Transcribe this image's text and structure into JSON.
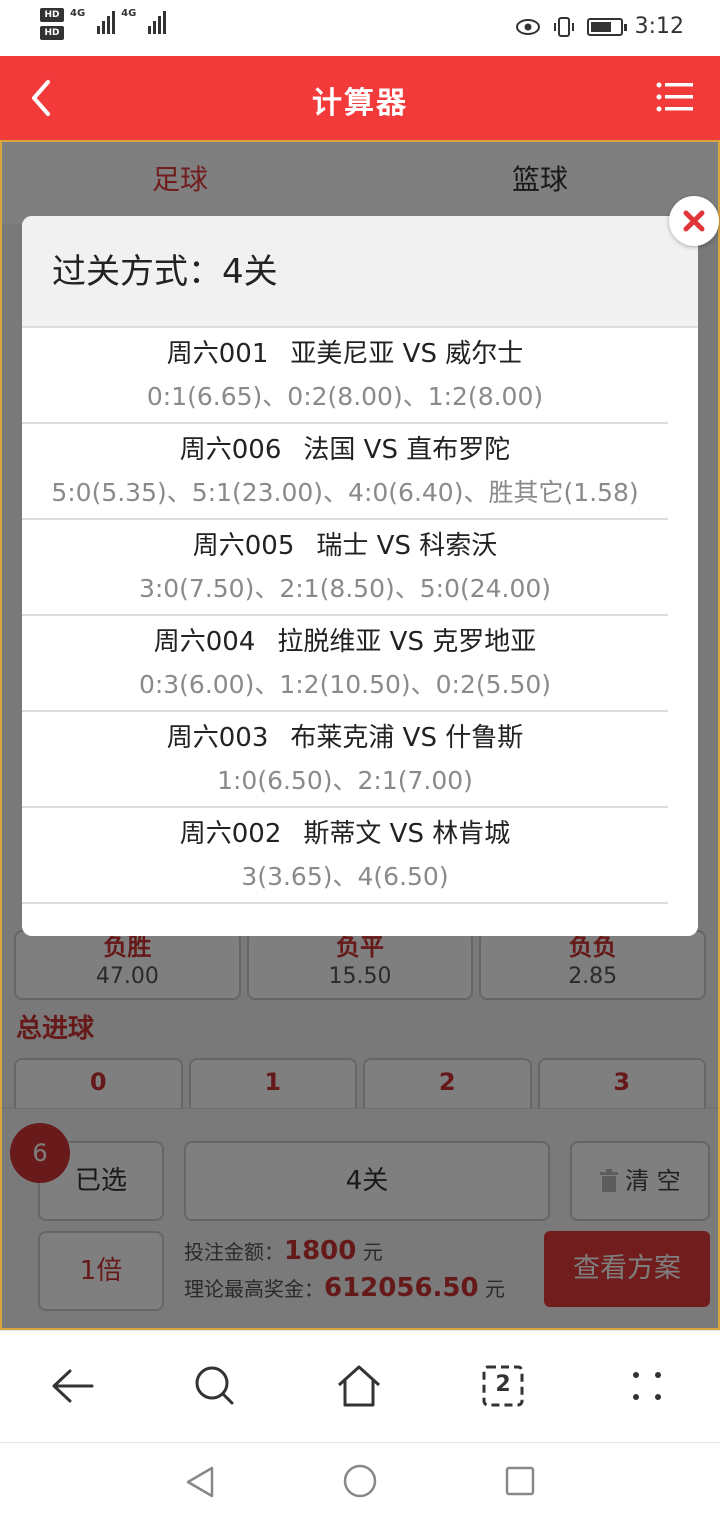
{
  "status_bar": {
    "network": "4G",
    "time": "3:12"
  },
  "header": {
    "title": "计算器"
  },
  "tabs": [
    {
      "label": "足球"
    },
    {
      "label": "篮球"
    }
  ],
  "odds": [
    {
      "name": "负胜",
      "value": "47.00"
    },
    {
      "name": "负平",
      "value": "15.50"
    },
    {
      "name": "负负",
      "value": "2.85"
    }
  ],
  "goals_section": {
    "title": "总进球",
    "options": [
      "0",
      "1",
      "2",
      "3"
    ]
  },
  "bottom": {
    "selected_count": "6",
    "selected_label": "已选",
    "pass_value": "4关",
    "clear_label": "清 空",
    "multiplier": "1倍",
    "bet_amount_label": "投注金额：",
    "bet_amount": "1800",
    "unit": "元",
    "max_prize_label": "理论最高奖金：",
    "max_prize": "612056.50",
    "view_plan": "查看方案"
  },
  "modal": {
    "title": "过关方式：4关",
    "matches": [
      {
        "code": "周六001",
        "teams": "亚美尼亚 VS 威尔士",
        "odds": "0:1(6.65)、0:2(8.00)、1:2(8.00)"
      },
      {
        "code": "周六006",
        "teams": "法国 VS 直布罗陀",
        "odds": "5:0(5.35)、5:1(23.00)、4:0(6.40)、胜其它(1.58)"
      },
      {
        "code": "周六005",
        "teams": "瑞士 VS 科索沃",
        "odds": "3:0(7.50)、2:1(8.50)、5:0(24.00)"
      },
      {
        "code": "周六004",
        "teams": "拉脱维亚 VS 克罗地亚",
        "odds": "0:3(6.00)、1:2(10.50)、0:2(5.50)"
      },
      {
        "code": "周六003",
        "teams": "布莱克浦 VS 什鲁斯",
        "odds": "1:0(6.50)、2:1(7.00)"
      },
      {
        "code": "周六002",
        "teams": "斯蒂文 VS 林肯城",
        "odds": "3(3.65)、4(6.50)"
      }
    ]
  },
  "browser_nav": {
    "tabs_count": "2"
  },
  "colors": {
    "accent": "#f33a3a",
    "text_red": "#c33333"
  }
}
